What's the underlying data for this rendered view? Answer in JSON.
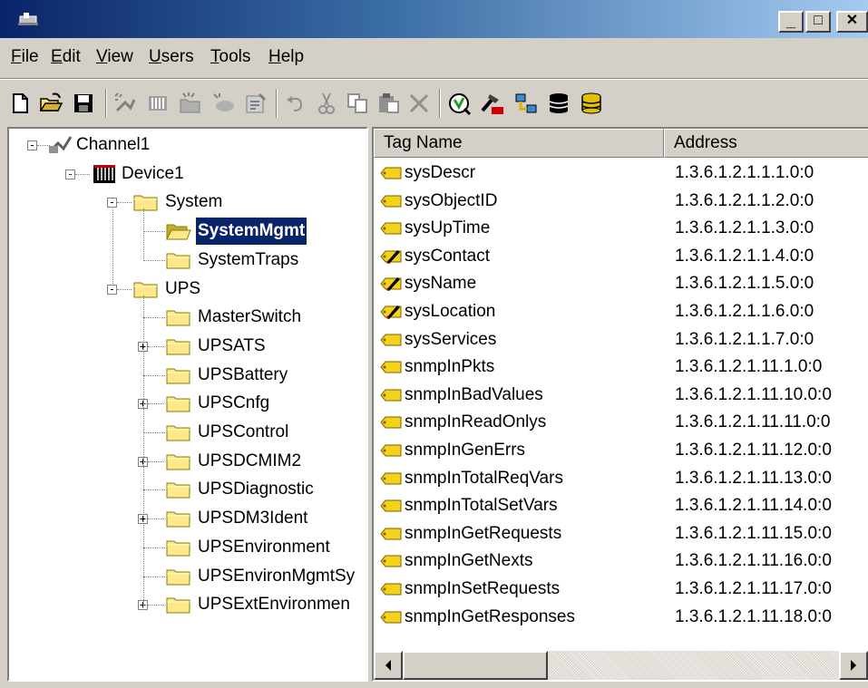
{
  "window": {
    "caption_buttons": {
      "minimize": "_",
      "maximize": "□",
      "close": "✕"
    }
  },
  "menu": [
    {
      "label": "File",
      "mnemonic": "F"
    },
    {
      "label": "Edit",
      "mnemonic": "E"
    },
    {
      "label": "View",
      "mnemonic": "V"
    },
    {
      "label": "Users",
      "mnemonic": "U"
    },
    {
      "label": "Tools",
      "mnemonic": "T"
    },
    {
      "label": "Help",
      "mnemonic": "H"
    }
  ],
  "toolbar": {
    "icons": [
      "new-icon",
      "open-icon",
      "save-icon",
      "new-channel-icon",
      "new-device-icon",
      "new-group-icon",
      "new-tag-icon",
      "properties-icon",
      "undo-icon",
      "cut-icon",
      "copy-icon",
      "paste-icon",
      "delete-icon",
      "quick-client-icon",
      "opc-icon",
      "runtime-connect-icon",
      "database-icon",
      "database-export-icon"
    ]
  },
  "tree": {
    "channel": "Channel1",
    "device": "Device1",
    "system_group": "System",
    "system_children": [
      "SystemMgmt",
      "SystemTraps"
    ],
    "selected": "SystemMgmt",
    "ups_group": "UPS",
    "ups_children": [
      {
        "label": "MasterSwitch",
        "expandable": false
      },
      {
        "label": "UPSATS",
        "expandable": true
      },
      {
        "label": "UPSBattery",
        "expandable": false
      },
      {
        "label": "UPSCnfg",
        "expandable": true
      },
      {
        "label": "UPSControl",
        "expandable": false
      },
      {
        "label": "UPSDCMIM2",
        "expandable": true
      },
      {
        "label": "UPSDiagnostic",
        "expandable": false
      },
      {
        "label": "UPSDM3Ident",
        "expandable": true
      },
      {
        "label": "UPSEnvironment",
        "expandable": false
      },
      {
        "label": "UPSEnvironMgmtSy",
        "expandable": false
      },
      {
        "label": "UPSExtEnvironmen",
        "expandable": true
      }
    ]
  },
  "list": {
    "columns": [
      "Tag Name",
      "Address"
    ],
    "rows": [
      {
        "name": "sysDescr",
        "address": "1.3.6.1.2.1.1.1.0:0",
        "writable": false
      },
      {
        "name": "sysObjectID",
        "address": "1.3.6.1.2.1.1.2.0:0",
        "writable": false
      },
      {
        "name": "sysUpTime",
        "address": "1.3.6.1.2.1.1.3.0:0",
        "writable": false
      },
      {
        "name": "sysContact",
        "address": "1.3.6.1.2.1.1.4.0:0",
        "writable": true
      },
      {
        "name": "sysName",
        "address": "1.3.6.1.2.1.1.5.0:0",
        "writable": true
      },
      {
        "name": "sysLocation",
        "address": "1.3.6.1.2.1.1.6.0:0",
        "writable": true
      },
      {
        "name": "sysServices",
        "address": "1.3.6.1.2.1.1.7.0:0",
        "writable": false
      },
      {
        "name": "snmpInPkts",
        "address": "1.3.6.1.2.1.11.1.0:0",
        "writable": false
      },
      {
        "name": "snmpInBadValues",
        "address": "1.3.6.1.2.1.11.10.0:0",
        "writable": false
      },
      {
        "name": "snmpInReadOnlys",
        "address": "1.3.6.1.2.1.11.11.0:0",
        "writable": false
      },
      {
        "name": "snmpInGenErrs",
        "address": "1.3.6.1.2.1.11.12.0:0",
        "writable": false
      },
      {
        "name": "snmpInTotalReqVars",
        "address": "1.3.6.1.2.1.11.13.0:0",
        "writable": false
      },
      {
        "name": "snmpInTotalSetVars",
        "address": "1.3.6.1.2.1.11.14.0:0",
        "writable": false
      },
      {
        "name": "snmpInGetRequests",
        "address": "1.3.6.1.2.1.11.15.0:0",
        "writable": false
      },
      {
        "name": "snmpInGetNexts",
        "address": "1.3.6.1.2.1.11.16.0:0",
        "writable": false
      },
      {
        "name": "snmpInSetRequests",
        "address": "1.3.6.1.2.1.11.17.0:0",
        "writable": false
      },
      {
        "name": "snmpInGetResponses",
        "address": "1.3.6.1.2.1.11.18.0:0",
        "writable": false
      }
    ]
  },
  "colors": {
    "titlebar_start": "#0a246a",
    "titlebar_end": "#a6caf0",
    "selection": "#0a246a",
    "folder": "#ffe88c",
    "tag": "#f2d21c"
  }
}
